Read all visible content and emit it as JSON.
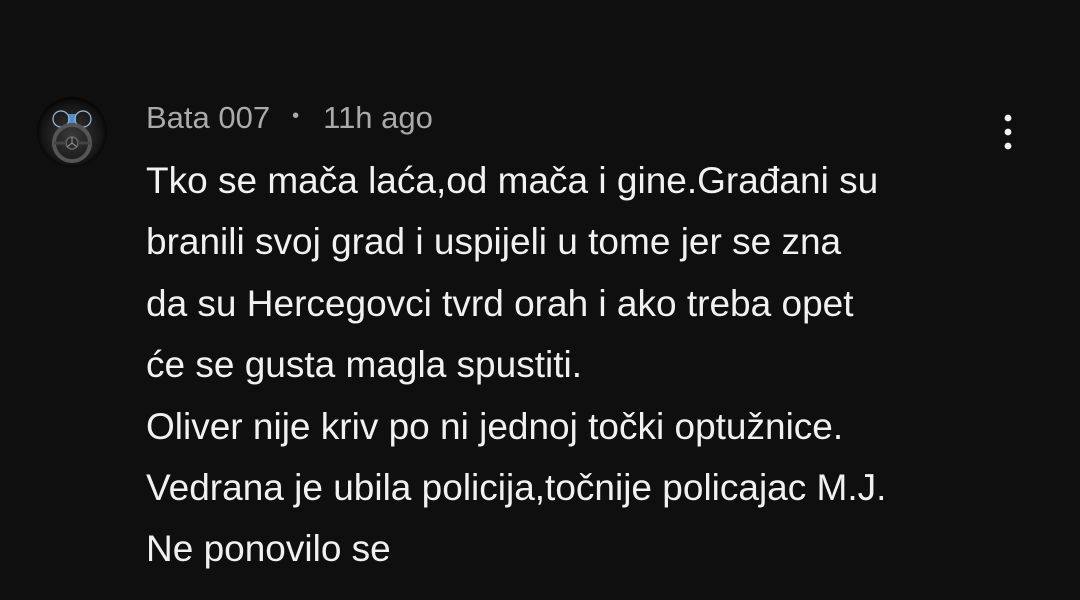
{
  "comment": {
    "author": "Bata 007",
    "separator": "•",
    "time": "11h ago",
    "lines": [
      "Tko se mača laća,od mača i gine.Građani su",
      "branili svoj grad i uspijeli u tome jer se zna",
      "da su Hercegovci tvrd orah i ako treba opet",
      "će se gusta magla spustiti.",
      "Oliver nije kriv po ni jednoj točki optužnice.",
      "Vedrana je ubila policija,točnije policajac M.J.",
      "Ne ponovilo se"
    ],
    "avatar_icon": "dashboard-avatar-icon",
    "menu_icon": "more-vertical-icon"
  },
  "colors": {
    "background": "#0f0f0f",
    "meta_text": "#aaaaaa",
    "body_text": "#f1f1f1"
  }
}
